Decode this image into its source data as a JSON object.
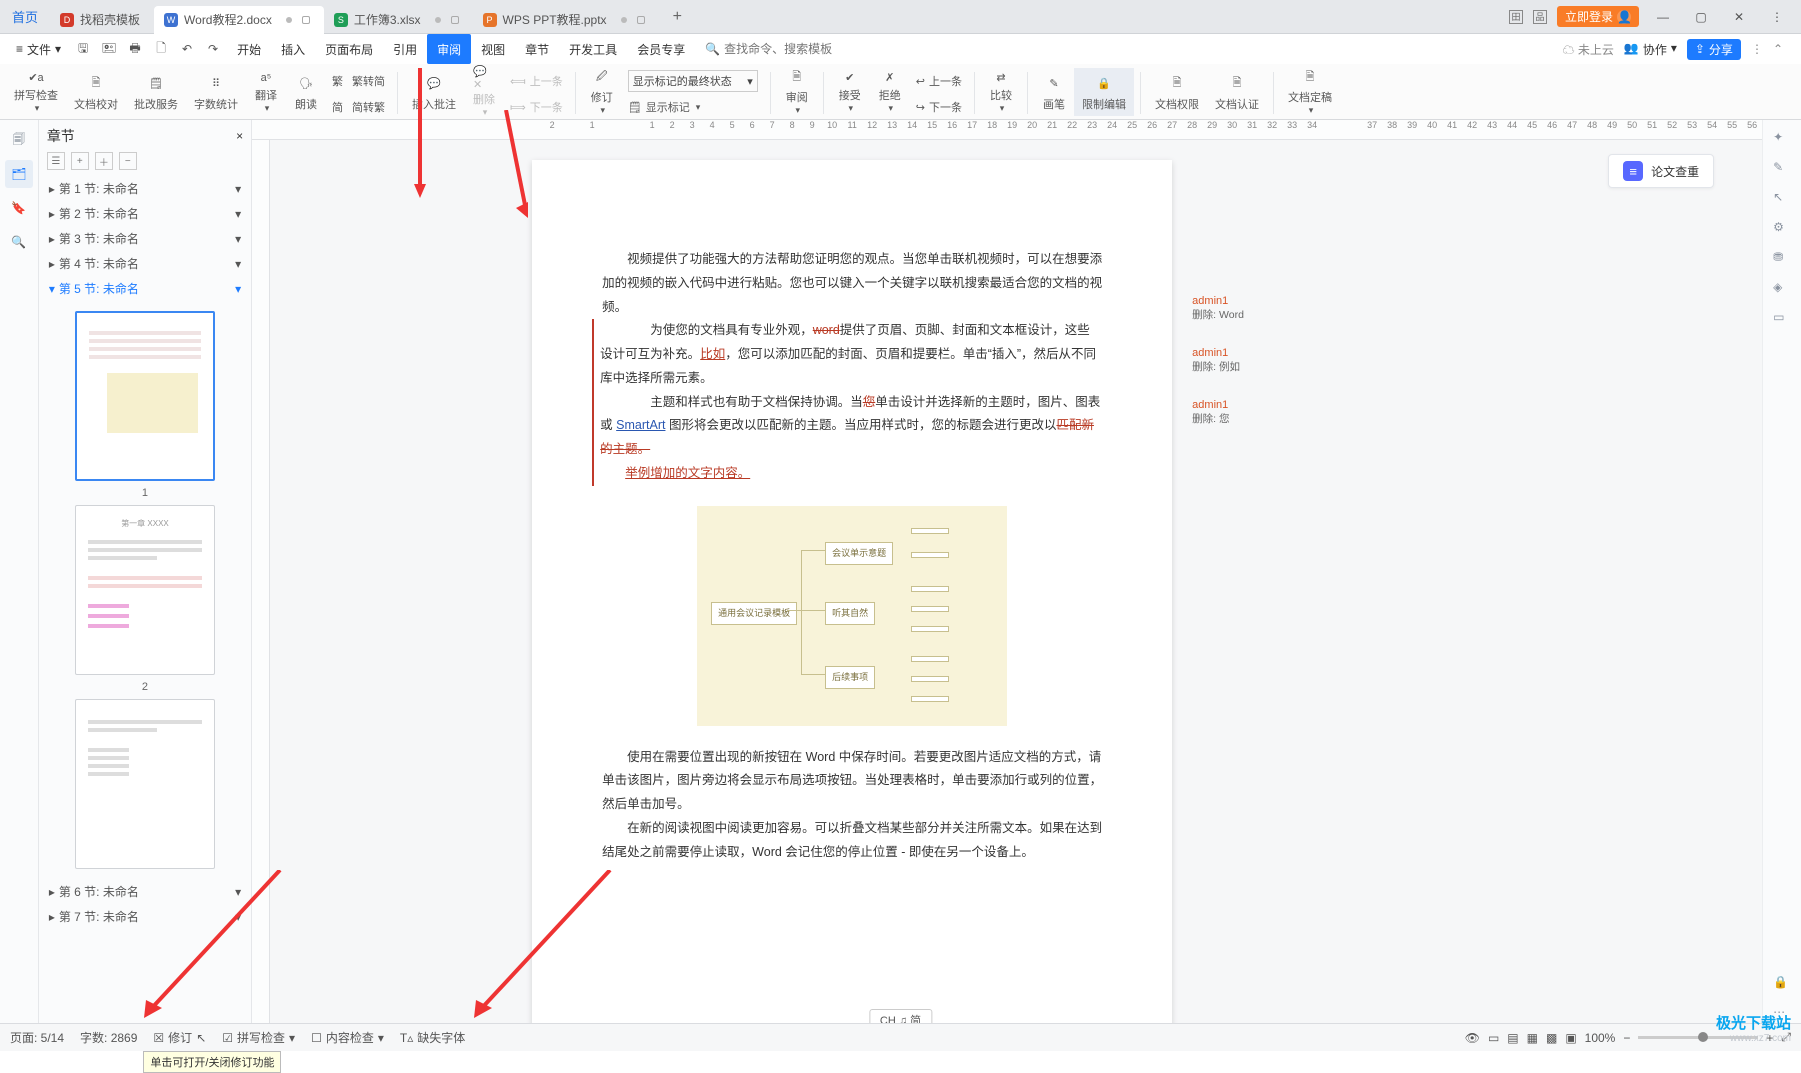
{
  "window": {
    "home": "首页",
    "tabs": [
      {
        "label": "找稻壳模板",
        "iconColor": "#d33a2a"
      },
      {
        "label": "Word教程2.docx",
        "iconColor": "#3e72d1",
        "active": true,
        "modified": true
      },
      {
        "label": "工作簿3.xlsx",
        "iconColor": "#1f9e57",
        "modified": true
      },
      {
        "label": "WPS PPT教程.pptx",
        "iconColor": "#e6742a",
        "modified": true
      }
    ],
    "login": "立即登录"
  },
  "menubar": {
    "file": "文件",
    "items": [
      "开始",
      "插入",
      "页面布局",
      "引用",
      "审阅",
      "视图",
      "章节",
      "开发工具",
      "会员专享"
    ],
    "active_index": 4,
    "search_placeholder": "查找命令、搜索模板",
    "cloud": "未上云",
    "coop": "协作",
    "share": "分享"
  },
  "ribbon": {
    "spellcheck": "拼写检查",
    "doc_proof": "文档校对",
    "doc_service": "批改服务",
    "word_count": "字数统计",
    "translate": "翻译",
    "read_aloud": "朗读",
    "s2t": "繁转简",
    "t2s": "简转繁",
    "insert_comment": "插入批注",
    "delete": "删除",
    "prev_rev": "上一条",
    "next_rev": "下一条",
    "revise": "修订",
    "markup_select": "显示标记的最终状态",
    "show_markup": "显示标记",
    "review": "审阅",
    "accept": "接受",
    "reject": "拒绝",
    "prev_comment": "上一条",
    "next_comment": "下一条",
    "compare": "比较",
    "ink": "画笔",
    "restrict": "限制编辑",
    "perm": "文档权限",
    "auth": "文档认证",
    "finalize": "文档定稿"
  },
  "sidebar": {
    "title": "章节",
    "sections": [
      {
        "label": "第 1 节: 未命名"
      },
      {
        "label": "第 2 节: 未命名"
      },
      {
        "label": "第 3 节: 未命名"
      },
      {
        "label": "第 4 节: 未命名"
      },
      {
        "label": "第 5 节: 未命名",
        "active": true
      },
      {
        "label": "第 6 节: 未命名"
      },
      {
        "label": "第 7 节: 未命名"
      }
    ],
    "thumb_labels": [
      "1",
      "2"
    ]
  },
  "document": {
    "p1": "视频提供了功能强大的方法帮助您证明您的观点。当您单击联机视频时，可以在想要添加的视频的嵌入代码中进行粘贴。您也可以键入一个关键字以联机搜索最适合您的文档的视频。",
    "p2a": "为使您的文档具有专业外观，",
    "p2_word": "word",
    "p2b": "提供了页眉、页脚、封面和文本框设计，这些设计可互为补充。",
    "p2_biru": "比如",
    "p2c": "，您可以添加匹配的封面、页眉和提要栏。单击“插入”，然后从不同库中选择所需元素。",
    "p3a": "主题和样式也有助于文档保持协调。当",
    "p3_you": "您",
    "p3b": "单击设计并选择新的主题时，图片、图表或 ",
    "p3_sa": "SmartArt",
    "p3c": " 图形将会更改以匹配新的主题。当应用样式时，您的标题会进行更改以",
    "p3_del": "匹配新的主题。",
    "p3_ins": "举例增加的文字内容。",
    "p4": "使用在需要位置出现的新按钮在 Word 中保存时间。若要更改图片适应文档的方式，请单击该图片，图片旁边将会显示布局选项按钮。当处理表格时，单击要添加行或列的位置，然后单击加号。",
    "p5": "在新的阅读视图中阅读更加容易。可以折叠文档某些部分并关注所需文本。如果在达到结尾处之前需要停止读取，Word 会记住您的停止位置 - 即使在另一个设备上。",
    "chart_labels": {
      "root": "通用会议记录模板",
      "l1a": "会议单示意题",
      "l1b": "听其自然",
      "l1c": "后续事项"
    }
  },
  "comments": [
    {
      "user": "admin1",
      "text": "删除: Word"
    },
    {
      "user": "admin1",
      "text": "删除: 例如"
    },
    {
      "user": "admin1",
      "text": "删除: 您"
    }
  ],
  "right_float": {
    "thesis_check": "论文查重"
  },
  "statusbar": {
    "page": "页面: 5/14",
    "words": "字数: 2869",
    "revise": "修订",
    "spell": "拼写检查",
    "content": "内容检查",
    "missing_font": "缺失字体",
    "tooltip": "单击可打开/关闭修订功能",
    "lang_badge": "CH ♫ 简",
    "zoom_pct": "100%",
    "zoom_minus": "−",
    "zoom_plus": "+"
  },
  "watermark": {
    "line1": "极光下载站",
    "line2": "www.xz7.com"
  }
}
